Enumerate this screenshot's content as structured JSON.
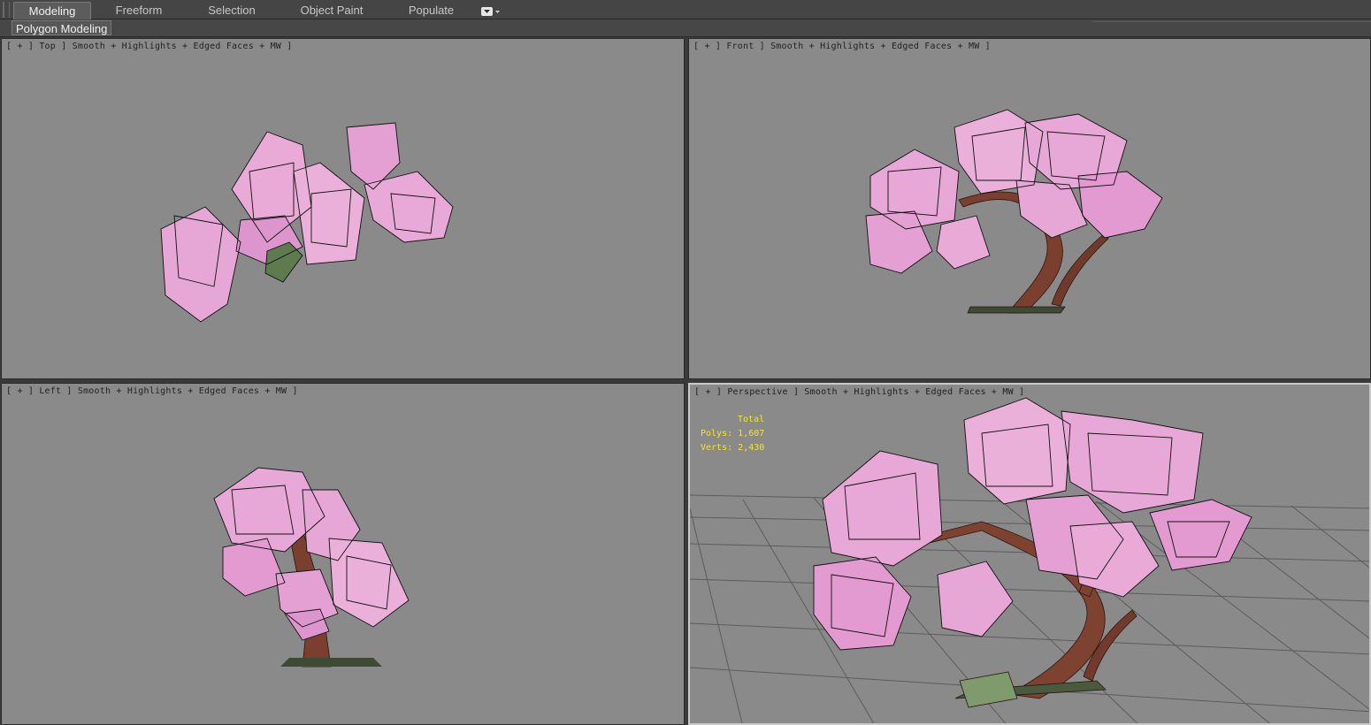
{
  "ribbon": {
    "tabs": [
      {
        "label": "Modeling",
        "active": true
      },
      {
        "label": "Freeform",
        "active": false
      },
      {
        "label": "Selection",
        "active": false
      },
      {
        "label": "Object Paint",
        "active": false
      },
      {
        "label": "Populate",
        "active": false
      }
    ],
    "dropdown_icon": "customize-dropdown-icon",
    "panel_tab": "Polygon Modeling"
  },
  "viewports": [
    {
      "id": "top",
      "label": "[ + ] Top ] Smooth + Highlights + Edged Faces + MW ]"
    },
    {
      "id": "front",
      "label": "[ + ] Front ] Smooth + Highlights + Edged Faces + MW ]"
    },
    {
      "id": "left",
      "label": "[ + ] Left ] Smooth + Highlights + Edged Faces + MW ]"
    },
    {
      "id": "perspective",
      "label": "[ + ] Perspective ] Smooth + Highlights + Edged Faces + MW ]"
    }
  ],
  "stats": {
    "total_label": "Total",
    "polys_label": "Polys:",
    "polys_value": "1,607",
    "verts_label": "Verts:",
    "verts_value": "2,430"
  },
  "colors": {
    "viewport_bg": "#8a8a8a",
    "blossom": "#e29ad0",
    "blossom_light": "#f5d5ec",
    "trunk": "#7a3f2e",
    "wire": "#111111",
    "stats_text": "#f2e430",
    "grid": "#5a5a5a"
  }
}
